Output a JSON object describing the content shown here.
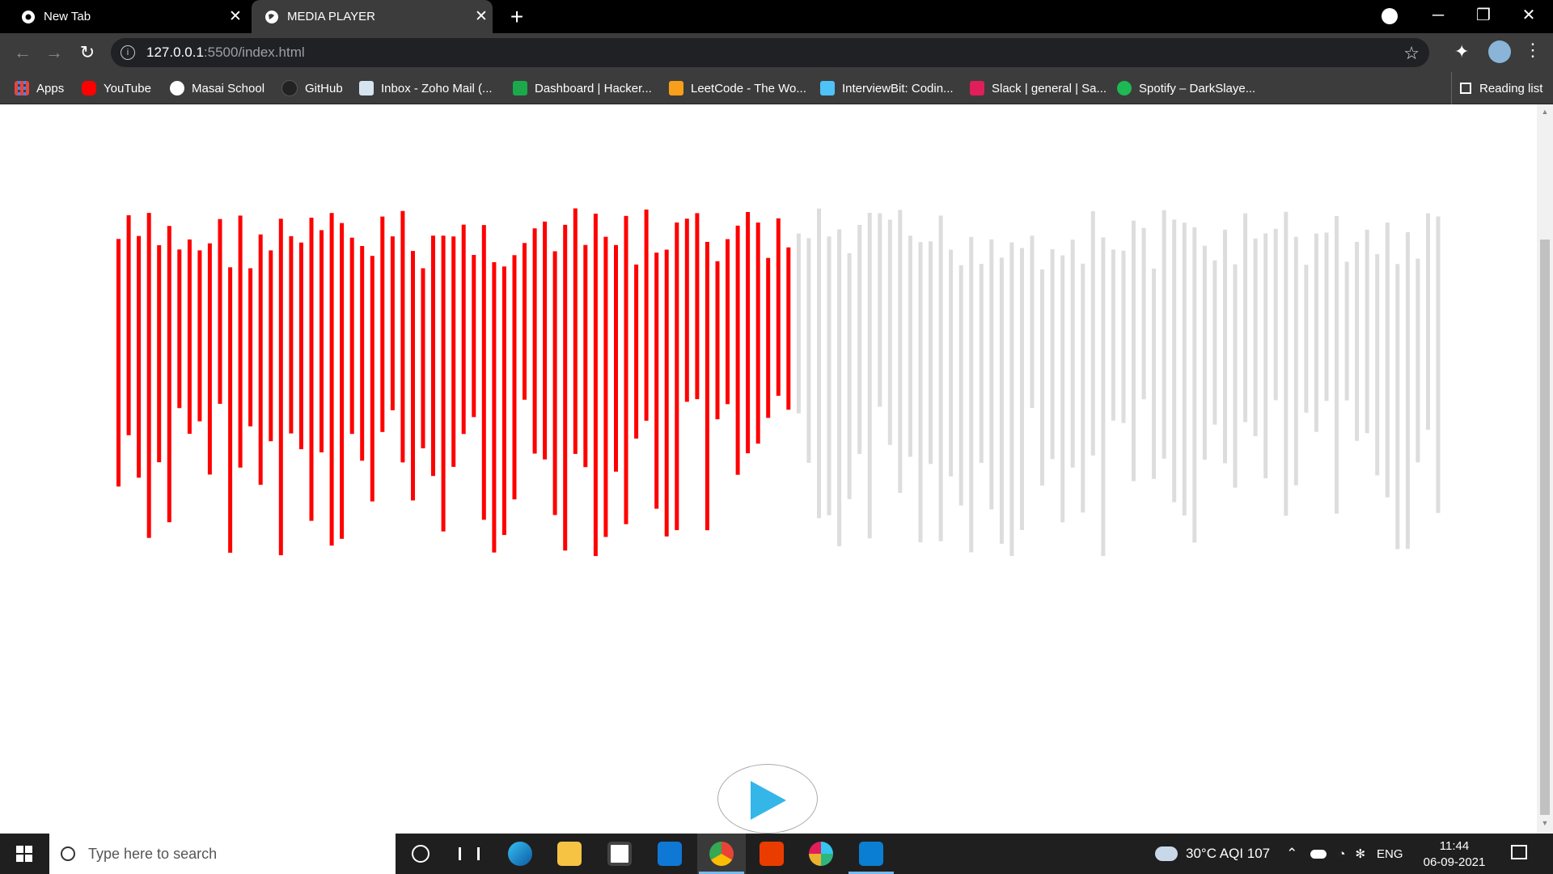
{
  "browser": {
    "tabs": [
      {
        "title": "New Tab",
        "close": "✕"
      },
      {
        "title": "MEDIA PLAYER",
        "close": "✕"
      }
    ],
    "new_tab": "+",
    "window_controls": {
      "minimize": "─",
      "restore": "❐",
      "close": "✕"
    },
    "address": {
      "host": "127.0.0.1",
      "rest": ":5500/index.html"
    },
    "bookmarks": [
      {
        "label": "Apps",
        "icon": "apps-grid-icon",
        "color": "#e8453c"
      },
      {
        "label": "YouTube",
        "icon": "youtube-icon",
        "color": "#ff0000"
      },
      {
        "label": "Masai School",
        "icon": "globe-icon",
        "color": "#ffffff"
      },
      {
        "label": "GitHub",
        "icon": "github-icon",
        "color": "#333333"
      },
      {
        "label": "Inbox - Zoho Mail (...",
        "icon": "zoho-mail-icon",
        "color": "#d6e4f0"
      },
      {
        "label": "Dashboard | Hacker...",
        "icon": "hackerrank-icon",
        "color": "#1ba94c"
      },
      {
        "label": "LeetCode - The Wo...",
        "icon": "leetcode-icon",
        "color": "#f89f1b"
      },
      {
        "label": "InterviewBit: Codin...",
        "icon": "interviewbit-icon",
        "color": "#4fc3f7"
      },
      {
        "label": "Slack | general | Sa...",
        "icon": "slack-icon",
        "color": "#e01e5a"
      },
      {
        "label": "Spotify – DarkSlaye...",
        "icon": "spotify-icon",
        "color": "#1db954"
      }
    ],
    "reading_list": "Reading list"
  },
  "player": {
    "played_color": "#ff0000",
    "unplayed_color": "#dddddd",
    "play_color": "#35b6e8",
    "progress_fraction": 0.51
  },
  "taskbar": {
    "search_placeholder": "Type here to search",
    "weather": "30°C  AQI 107",
    "language": "ENG",
    "time": "11:44",
    "date": "06-09-2021",
    "apps": [
      "cortana-icon",
      "task-view-icon",
      "edge-icon",
      "file-explorer-icon",
      "store-icon",
      "mail-icon",
      "chrome-icon",
      "office-icon",
      "slack-icon",
      "vscode-icon"
    ]
  }
}
